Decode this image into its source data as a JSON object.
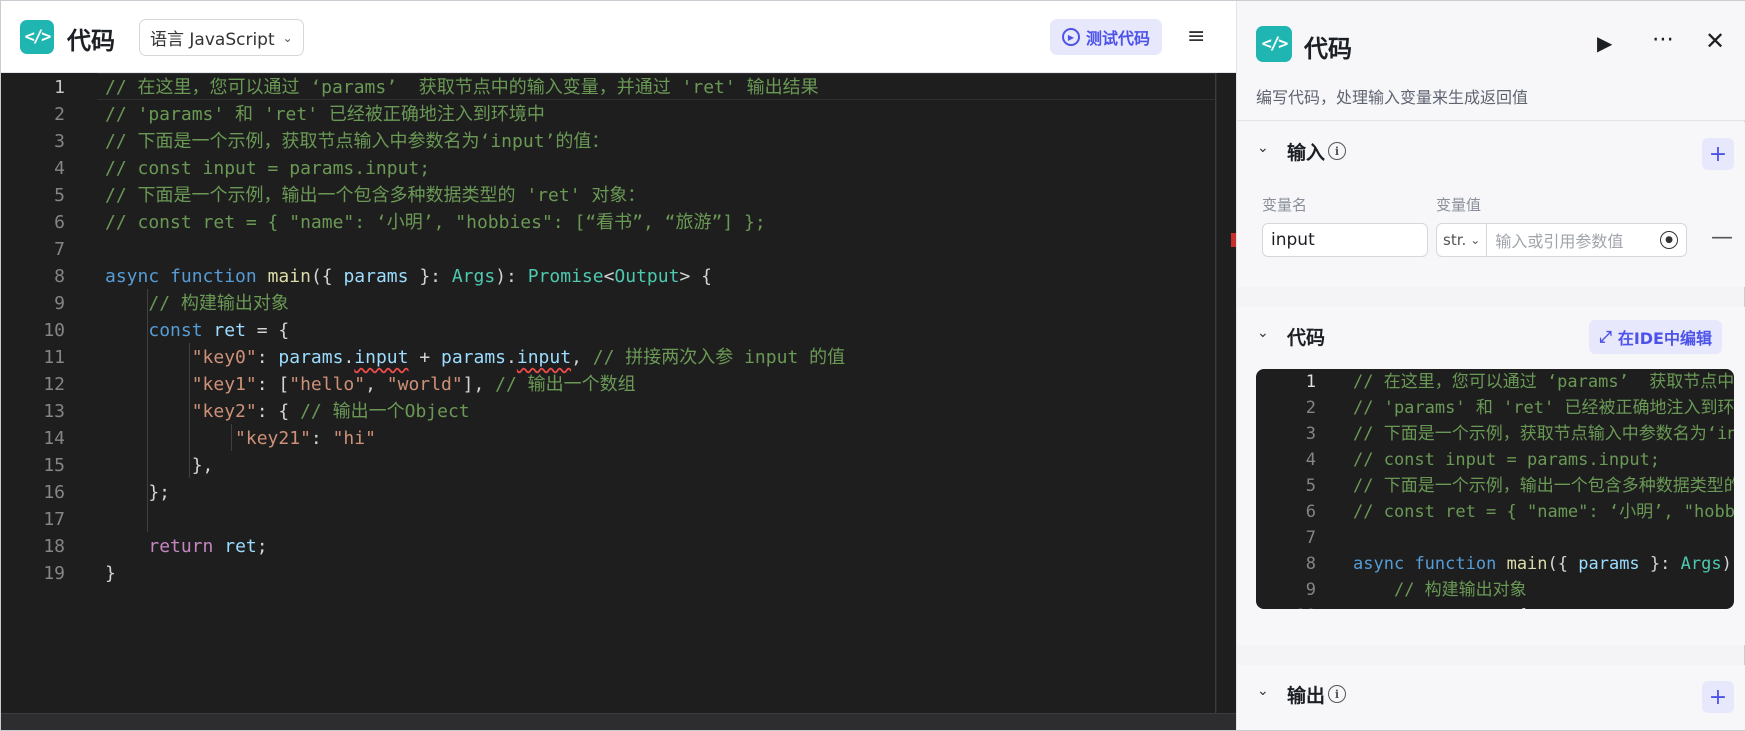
{
  "editor": {
    "title": "代码",
    "logo_glyph": "</>",
    "language_label": "语言 JavaScript",
    "test_button": "测试代码",
    "lines": [
      {
        "n": "1",
        "segs": [
          [
            "c",
            "// 在这里，您可以通过 ‘params’  获取节点中的输入变量，并通过 'ret' 输出结果"
          ]
        ]
      },
      {
        "n": "2",
        "segs": [
          [
            "c",
            "// 'params' 和 'ret' 已经被正确地注入到环境中"
          ]
        ]
      },
      {
        "n": "3",
        "segs": [
          [
            "c",
            "// 下面是一个示例，获取节点输入中参数名为‘input’的值："
          ]
        ]
      },
      {
        "n": "4",
        "segs": [
          [
            "c",
            "// const input = params.input;"
          ]
        ]
      },
      {
        "n": "5",
        "segs": [
          [
            "c",
            "// 下面是一个示例，输出一个包含多种数据类型的 'ret' 对象："
          ]
        ]
      },
      {
        "n": "6",
        "segs": [
          [
            "c",
            "// const ret = { \"name\": ‘小明’, \"hobbies\": [“看书”, “旅游”] };"
          ]
        ]
      },
      {
        "n": "7",
        "segs": []
      },
      {
        "n": "8",
        "segs": [
          [
            "k",
            "async"
          ],
          [
            "p",
            " "
          ],
          [
            "k",
            "function"
          ],
          [
            "p",
            " "
          ],
          [
            "f",
            "main"
          ],
          [
            "p",
            "({ "
          ],
          [
            "v",
            "params"
          ],
          [
            "p",
            " }: "
          ],
          [
            "t",
            "Args"
          ],
          [
            "p",
            "): "
          ],
          [
            "t",
            "Promise"
          ],
          [
            "p",
            "<"
          ],
          [
            "t",
            "Output"
          ],
          [
            "p",
            "> {"
          ]
        ]
      },
      {
        "n": "9",
        "segs": [
          [
            "p",
            "    "
          ],
          [
            "c",
            "// 构建输出对象"
          ]
        ]
      },
      {
        "n": "10",
        "segs": [
          [
            "p",
            "    "
          ],
          [
            "k",
            "const"
          ],
          [
            "p",
            " "
          ],
          [
            "v",
            "ret"
          ],
          [
            "p",
            " = {"
          ]
        ]
      },
      {
        "n": "11",
        "segs": [
          [
            "p",
            "        "
          ],
          [
            "s",
            "\"key0\""
          ],
          [
            "p",
            ": "
          ],
          [
            "v",
            "params"
          ],
          [
            "p",
            "."
          ],
          [
            "v sq",
            "input"
          ],
          [
            "p",
            " + "
          ],
          [
            "v",
            "params"
          ],
          [
            "p",
            "."
          ],
          [
            "v sq",
            "input"
          ],
          [
            "p",
            ", "
          ],
          [
            "c",
            "// 拼接两次入参 input 的值"
          ]
        ]
      },
      {
        "n": "12",
        "segs": [
          [
            "p",
            "        "
          ],
          [
            "s",
            "\"key1\""
          ],
          [
            "p",
            ": ["
          ],
          [
            "s",
            "\"hello\""
          ],
          [
            "p",
            ", "
          ],
          [
            "s",
            "\"world\""
          ],
          [
            "p",
            "], "
          ],
          [
            "c",
            "// 输出一个数组"
          ]
        ]
      },
      {
        "n": "13",
        "segs": [
          [
            "p",
            "        "
          ],
          [
            "s",
            "\"key2\""
          ],
          [
            "p",
            ": { "
          ],
          [
            "c",
            "// 输出一个Object"
          ]
        ]
      },
      {
        "n": "14",
        "segs": [
          [
            "p",
            "            "
          ],
          [
            "s",
            "\"key21\""
          ],
          [
            "p",
            ": "
          ],
          [
            "s",
            "\"hi\""
          ]
        ]
      },
      {
        "n": "15",
        "segs": [
          [
            "p",
            "        },"
          ]
        ]
      },
      {
        "n": "16",
        "segs": [
          [
            "p",
            "    };"
          ]
        ]
      },
      {
        "n": "17",
        "segs": []
      },
      {
        "n": "18",
        "segs": [
          [
            "p",
            "    "
          ],
          [
            "kw",
            "return"
          ],
          [
            "p",
            " "
          ],
          [
            "v",
            "ret"
          ],
          [
            "p",
            ";"
          ]
        ]
      },
      {
        "n": "19",
        "segs": [
          [
            "p",
            "}"
          ]
        ]
      }
    ]
  },
  "panel": {
    "title": "代码",
    "logo_glyph": "</>",
    "description": "编写代码，处理输入变量来生成返回值",
    "input_section": {
      "title": "输入",
      "col_name": "变量名",
      "col_value": "变量值",
      "var_name": "input",
      "type_label": "str.",
      "value_placeholder": "输入或引用参数值"
    },
    "code_section": {
      "title": "代码",
      "ide_button": "在IDE中编辑"
    },
    "output_section": {
      "title": "输出"
    }
  },
  "icons": {
    "menu": "menu-collapse-icon",
    "run": "play-icon",
    "more": "more-icon",
    "close": "close-icon",
    "info": "info-icon",
    "add": "plus-icon",
    "remove": "minus-icon",
    "variable": "variable-reference-icon",
    "expand": "expand-icon"
  },
  "colors": {
    "brand": "#1fb5b0",
    "accent": "#4d53e8",
    "accent_bg": "#e8e8fd",
    "editor_bg": "#1e1e1e"
  }
}
